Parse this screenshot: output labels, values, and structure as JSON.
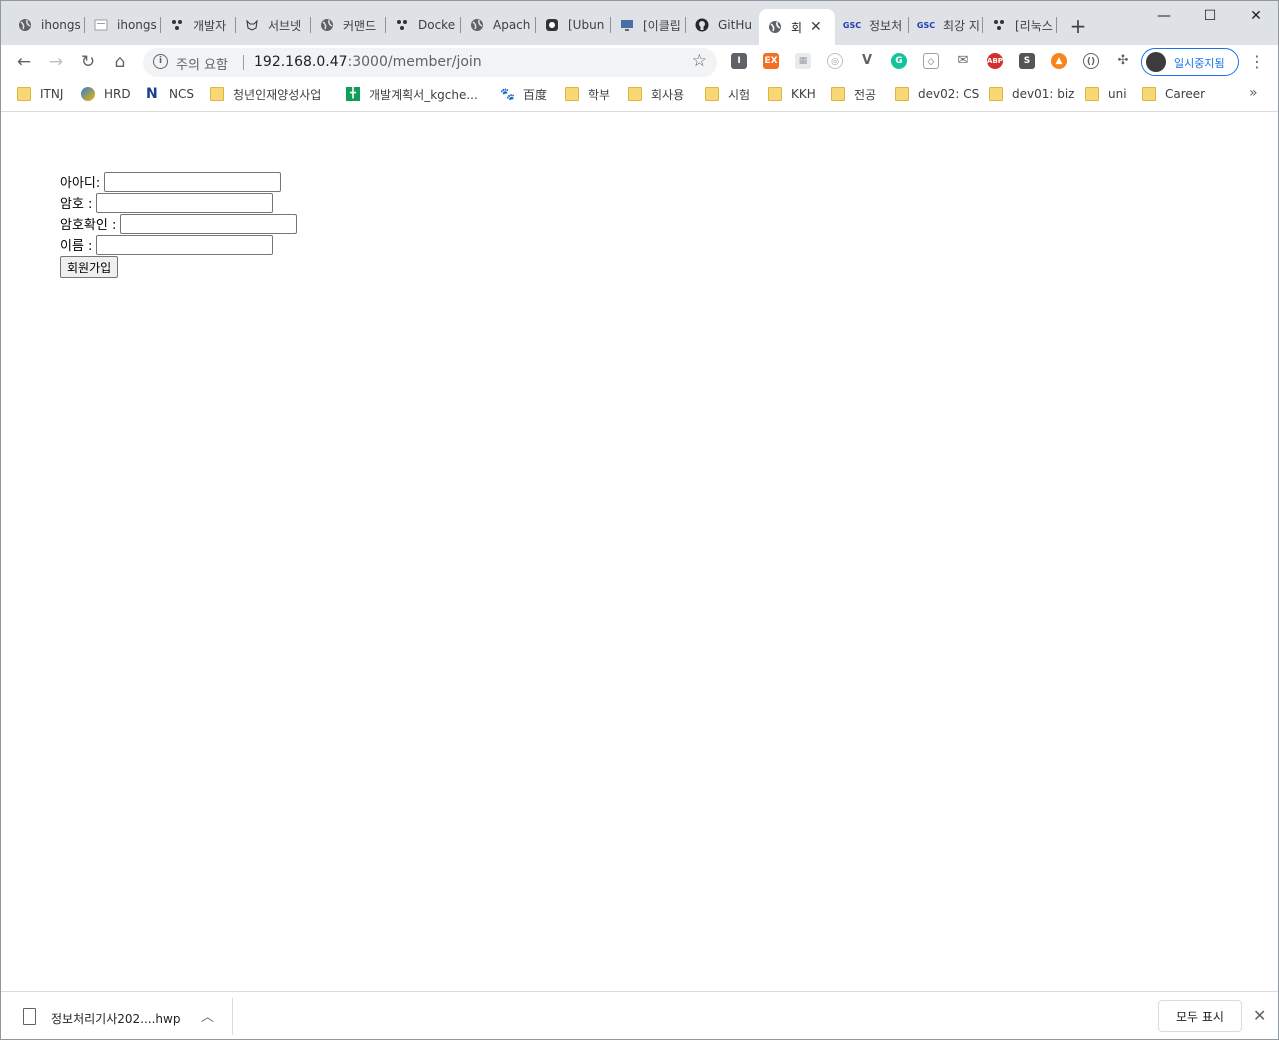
{
  "tabs": [
    {
      "title": "ihongs",
      "icon": "globe-icon"
    },
    {
      "title": "ihongs",
      "icon": "page-icon"
    },
    {
      "title": "개발자",
      "icon": "trello-icon"
    },
    {
      "title": "서브넷",
      "icon": "cat-icon"
    },
    {
      "title": "커맨드",
      "icon": "globe-icon"
    },
    {
      "title": "Docke",
      "icon": "trello-icon"
    },
    {
      "title": "Apach",
      "icon": "globe-icon"
    },
    {
      "title": "[Ubun",
      "icon": "octocat-icon"
    },
    {
      "title": "[이클립",
      "icon": "monitor-icon"
    },
    {
      "title": "GitHu",
      "icon": "github-icon"
    },
    {
      "title": "회",
      "icon": "globe-icon",
      "active": true
    },
    {
      "title": "정보처",
      "icon": "gsc-icon"
    },
    {
      "title": "최강 지",
      "icon": "gsc-icon"
    },
    {
      "title": "[리눅스",
      "icon": "trello-icon"
    }
  ],
  "omnibox": {
    "security_label": "주의 요함",
    "host": "192.168.0.47",
    "path": ":3000/member/join"
  },
  "profile_label": "일시중지됨",
  "bookmarks": [
    {
      "label": "ITNJ",
      "icon": "folder"
    },
    {
      "label": "HRD",
      "icon": "hrd"
    },
    {
      "label": "NCS",
      "icon": "ncs"
    },
    {
      "label": "청년인재양성사업",
      "icon": "folder"
    },
    {
      "label": "개발계획서_kgche...",
      "icon": "sheets"
    },
    {
      "label": "百度",
      "icon": "baidu"
    },
    {
      "label": "학부",
      "icon": "folder"
    },
    {
      "label": "회사용",
      "icon": "folder"
    },
    {
      "label": "시험",
      "icon": "folder"
    },
    {
      "label": "KKH",
      "icon": "folder"
    },
    {
      "label": "전공",
      "icon": "folder"
    },
    {
      "label": "dev02: CS",
      "icon": "folder"
    },
    {
      "label": "dev01: biz",
      "icon": "folder"
    },
    {
      "label": "uni",
      "icon": "folder"
    },
    {
      "label": "Career",
      "icon": "folder"
    }
  ],
  "form": {
    "id_label": "아아디:",
    "pw_label": "암호 :",
    "pw_confirm_label": "암호확인 :",
    "name_label": "이름 :",
    "submit_label": "회원가입"
  },
  "download": {
    "filename": "정보처리기사202....hwp",
    "show_all": "모두 표시"
  },
  "colors": {
    "accent": "#1a73e8",
    "tabstrip": "#dee1e6",
    "folder": "#f8d775"
  }
}
